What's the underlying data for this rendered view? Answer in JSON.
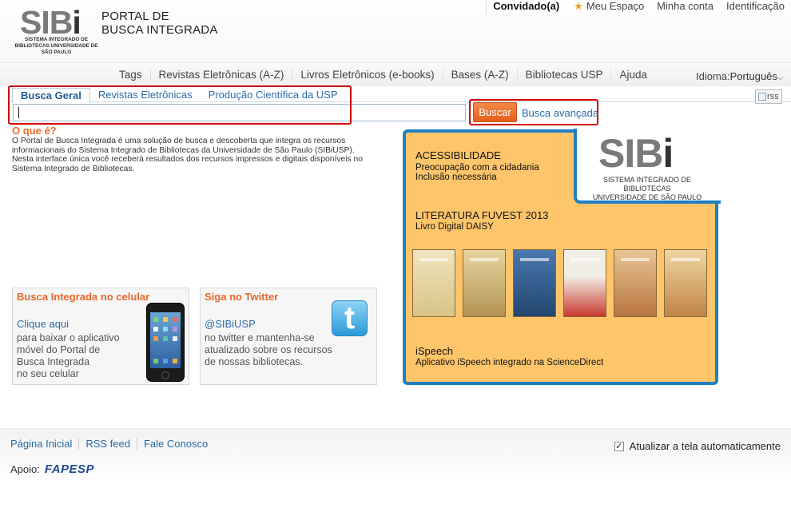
{
  "header": {
    "logo_text": "SIBi",
    "logo_subtitle": "SISTEMA INTEGRADO DE BIBLIOTECAS UNIVERSIDADE DE SÃO PAULO",
    "portal_title_line1": "PORTAL DE",
    "portal_title_line2": "BUSCA INTEGRADA"
  },
  "userbar": {
    "guest": "Convidado(a)",
    "my_space": "Meu Espaço",
    "my_account": "Minha conta",
    "identification": "Identificação"
  },
  "topnav": {
    "items": [
      "Tags",
      "Revistas Eletrônicas (A-Z)",
      "Livros Eletrônicos (e-books)",
      "Bases (A-Z)",
      "Bibliotecas USP",
      "Ajuda"
    ],
    "language_label": "Idioma:",
    "language_value": "Português"
  },
  "search": {
    "tabs": [
      "Busca Geral",
      "Revistas Eletrônicas",
      "Produção Científica da USP"
    ],
    "input_value": "",
    "button_label": "Buscar",
    "advanced_label": "Busca avançada",
    "rss_label": "rss"
  },
  "about": {
    "title": "O que é?",
    "text": "O Portal de Busca Integrada é uma solução de busca e descoberta que integra os recursos informacionais do Sistema Integrado de Bibliotecas da Universidade de São Paulo (SIBiUSP). Nesta interface única você receberá resultados dos recursos impressos e digitais disponíveis no Sistema Integrado de Bibliotecas."
  },
  "mobile_card": {
    "title": "Busca Integrada no celular",
    "link": "Clique aqui",
    "text_lines": [
      "para baixar o aplicativo",
      "móvel do Portal de",
      "Busca Integrada",
      "no seu celular"
    ]
  },
  "twitter_card": {
    "title": "Siga no Twitter",
    "handle": "@SIBiUSP",
    "text_lines": [
      "no twitter e mantenha-se",
      "atualizado sobre os recursos",
      "de nossas bibliotecas."
    ]
  },
  "banner": {
    "logo_text": "SIBi",
    "logo_subtitle_line1": "SISTEMA INTEGRADO DE BIBLIOTECAS",
    "logo_subtitle_line2": "UNIVERSIDADE DE SÃO PAULO",
    "accessibility_title": "ACESSIBILIDADE",
    "accessibility_line1": "Preocupação com a cidadania",
    "accessibility_line2": "Inclusão necessária",
    "fuvest_title": "LITERATURA FUVEST 2013",
    "fuvest_line": "Livro Digital DAISY",
    "ispeech_title": "iSpeech",
    "ispeech_line": "Aplicativo iSpeech integrado na ScienceDirect",
    "book_colors": [
      "#e9dcae",
      "#d9c58e",
      "#2f5e92",
      "#c83a2e",
      "#d8955a",
      "#c9874a"
    ]
  },
  "footer": {
    "links": [
      "Página Inicial",
      "RSS feed",
      "Fale Conosco"
    ],
    "auto_refresh_label": "Atualizar a tela automaticamente",
    "auto_refresh_checked": true,
    "support_label": "Apoio:",
    "support_logo": "FAPESP"
  },
  "colors": {
    "accent_orange": "#e8682b",
    "link_blue": "#2a6aa8",
    "highlight_red": "#d00000",
    "banner_yellow": "#ffc56a",
    "banner_blue": "#1f7fc3"
  }
}
